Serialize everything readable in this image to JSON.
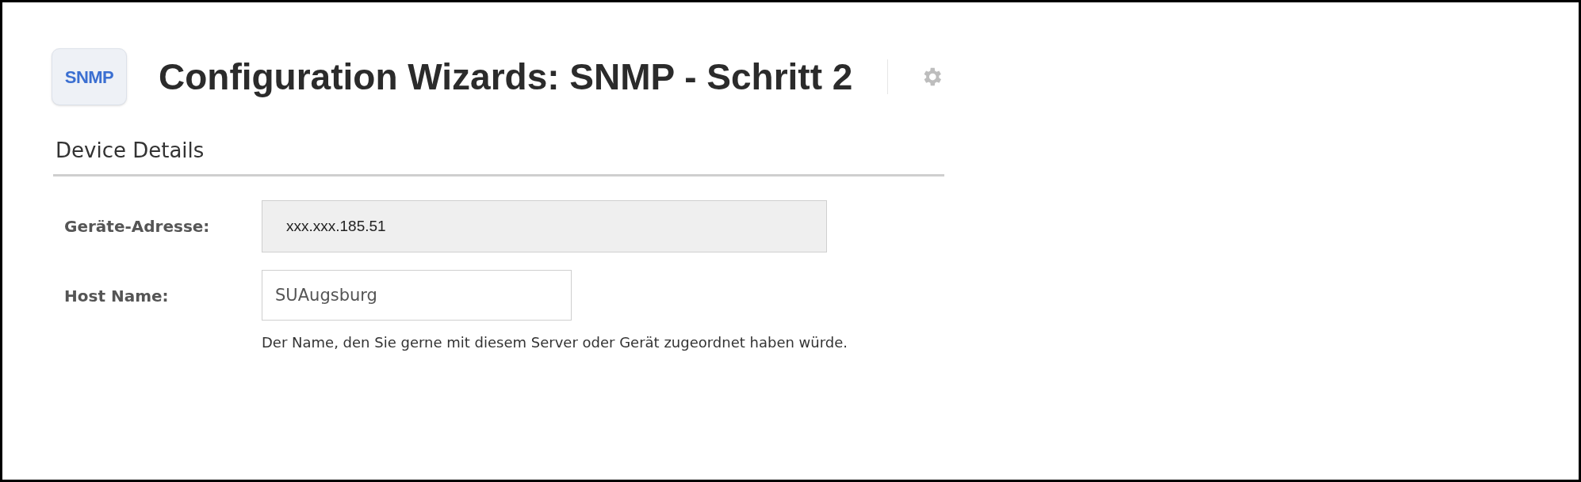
{
  "header": {
    "logo_text": "SNMP",
    "title": "Configuration Wizards: SNMP - Schritt 2"
  },
  "section": {
    "title": "Device Details"
  },
  "fields": [
    {
      "label": "Geräte-Adresse:",
      "value": "xxx.xxx.185.51",
      "disabled": true
    },
    {
      "label": "Host Name:",
      "value": "SUAugsburg",
      "disabled": false,
      "hint": "Der Name, den Sie gerne mit diesem Server oder Gerät zugeordnet haben würde."
    }
  ]
}
